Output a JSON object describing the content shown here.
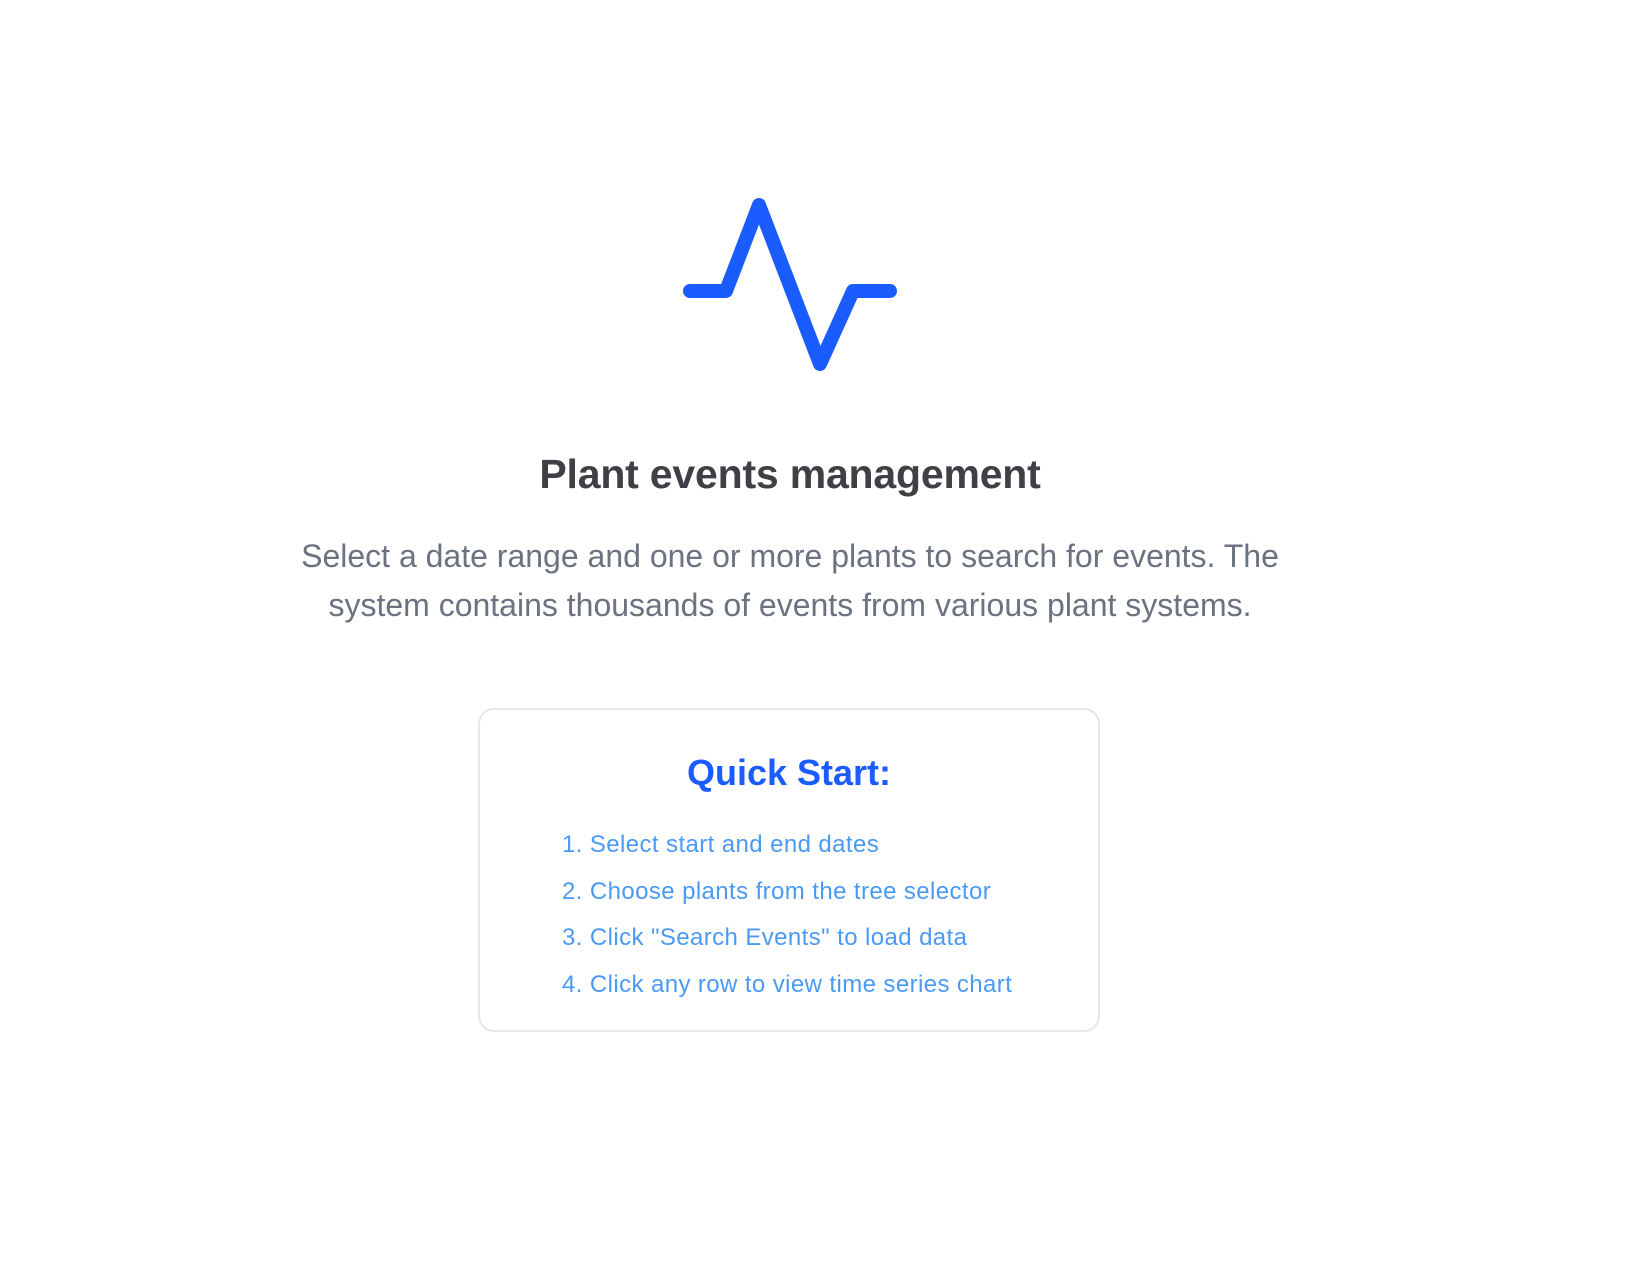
{
  "hero": {
    "icon": "activity-icon",
    "icon_color": "#1a5cff",
    "title": "Plant events management",
    "description_line1": "Select a date range and one or more plants to search for events.",
    "description_line2": "The system contains thousands of events from various plant systems."
  },
  "quick_start": {
    "title": "Quick Start:",
    "steps": [
      "1. Select start and end dates",
      "2. Choose plants from the tree selector",
      "3. Click \"Search Events\" to load data",
      "4. Click any row to view time series chart"
    ]
  },
  "colors": {
    "accent": "#1a5cff",
    "step_text": "#4a9af5",
    "heading": "#3f3f46",
    "muted_text": "#6b7280",
    "card_border": "#e5e7eb"
  }
}
